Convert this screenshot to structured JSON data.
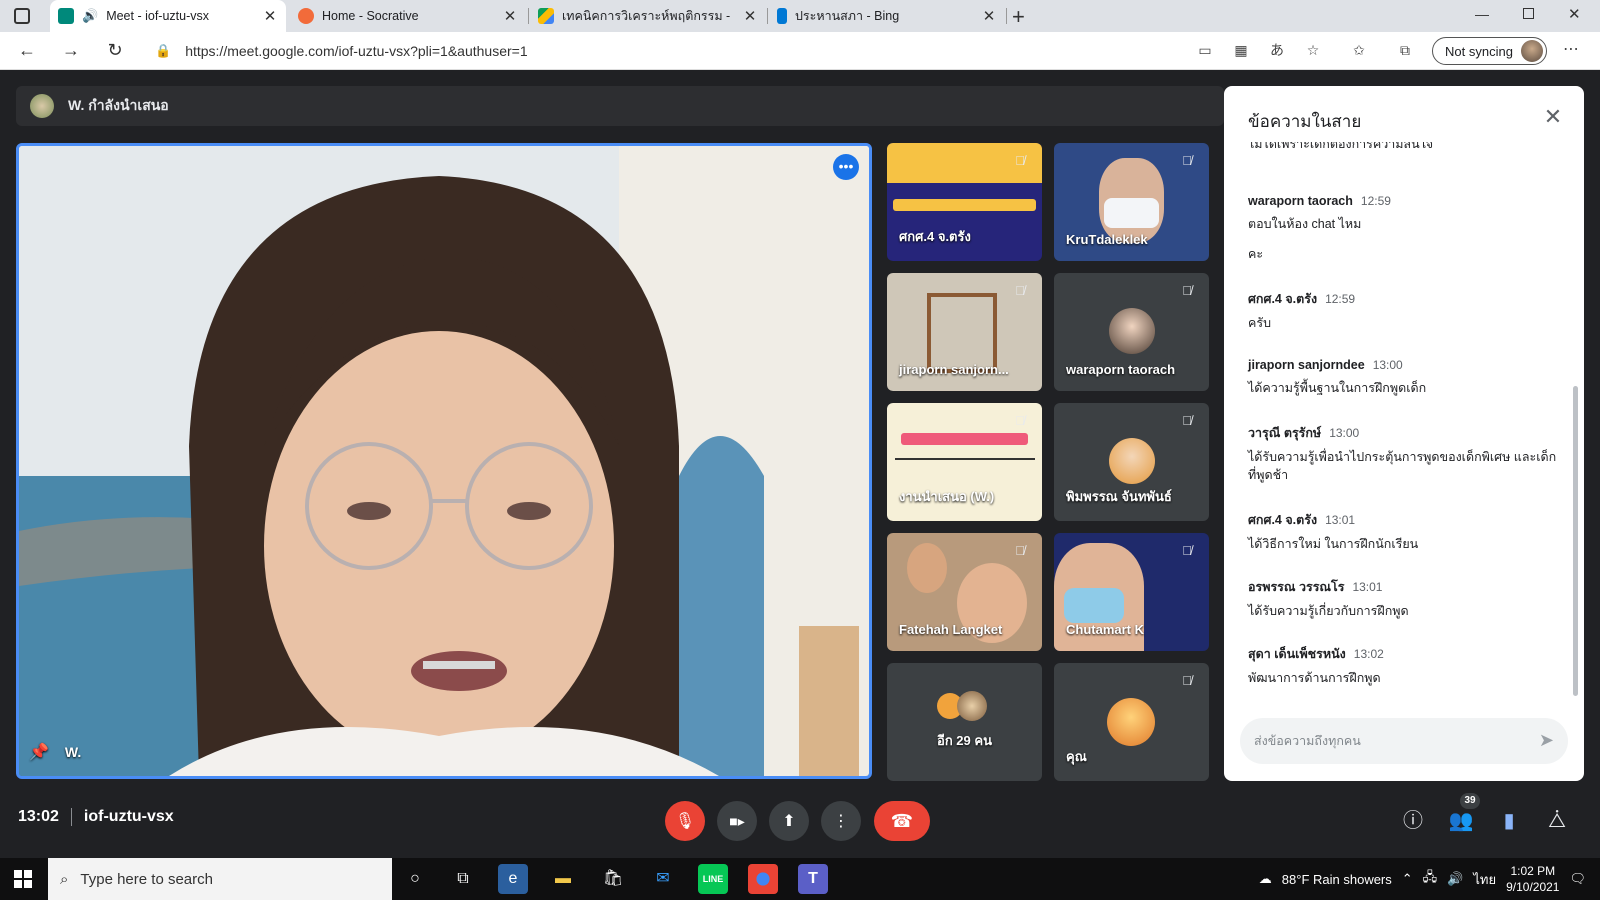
{
  "browser": {
    "tabs": [
      {
        "title": "Meet - iof-uztu-vsx",
        "color": "#00897b"
      },
      {
        "title": "Home - Socrative",
        "color": "#f26b3a"
      },
      {
        "title": "เทคนิคการวิเคราะห์พฤติกรรม - Goog",
        "color": "#4285f4"
      },
      {
        "title": "ประหานสภา - Bing",
        "color": "#0078d4"
      }
    ],
    "url": "https://meet.google.com/iof-uztu-vsx?pli=1&authuser=1",
    "sync_label": "Not syncing"
  },
  "meet": {
    "presenter_banner": "W. กำลังนำเสนอ",
    "main_name": "W.",
    "tiles": [
      {
        "name": "ศกศ.4 จ.ตรัง",
        "bg": "#26257a"
      },
      {
        "name": "KruTdaleklek",
        "bg": "#2f4a86"
      },
      {
        "name": "jiraporn sanjorn...",
        "bg": "#cfc7b8"
      },
      {
        "name": "waraporn taorach",
        "bg": "#3c4043"
      },
      {
        "name": "งานนำเสนอ (W.)",
        "bg": "#f6f0d8"
      },
      {
        "name": "พิมพรรณ จันทพันธ์",
        "bg": "#3c4043"
      },
      {
        "name": "Fatehah Langket",
        "bg": "#b89a7c"
      },
      {
        "name": "Chutamart K",
        "bg": "#1f2a6b"
      },
      {
        "name": "อีก 29 คน",
        "bg": "#3c4043"
      },
      {
        "name": "คุณ",
        "bg": "#3c4043"
      }
    ],
    "time": "13:02",
    "meeting_code": "iof-uztu-vsx",
    "participant_count": "39"
  },
  "chat": {
    "title": "ข้อความในสาย",
    "partial_text": "ไม่ได้เพราะเด็กต้องการความสนใจ",
    "messages": [
      {
        "sender": "waraporn taorach",
        "time": "12:59",
        "text": "ตอบในห้อง chat ไหม",
        "text2": "คะ"
      },
      {
        "sender": "ศกศ.4 จ.ตรัง",
        "time": "12:59",
        "text": "ครับ"
      },
      {
        "sender": "jiraporn sanjorndee",
        "time": "13:00",
        "text": "ได้ความรู้พื้นฐานในการฝึกพูดเด็ก"
      },
      {
        "sender": "วารุณี ตรุรักษ์",
        "time": "13:00",
        "text": "ได้รับความรู้เพื่อนำไปกระตุ้นการพูดของเด็กพิเศษ และเด็กที่พูดช้า"
      },
      {
        "sender": "ศกศ.4 จ.ตรัง",
        "time": "13:01",
        "text": "ได้วิธีการใหม่ ในการฝึกนักเรียน"
      },
      {
        "sender": "อรพรรณ วรรณโร",
        "time": "13:01",
        "text": "ได้รับความรู้เกี่ยวกับการฝึกพูด"
      },
      {
        "sender": "สุดา เด็นเพ็ชรหนัง",
        "time": "13:02",
        "text": "พัฒนาการด้านการฝึกพูด"
      }
    ],
    "input_placeholder": "ส่งข้อความถึงทุกคน"
  },
  "taskbar": {
    "search_placeholder": "Type here to search",
    "weather": "88°F  Rain showers",
    "lang": "ไทย",
    "clock_time": "1:02 PM",
    "clock_date": "9/10/2021"
  }
}
